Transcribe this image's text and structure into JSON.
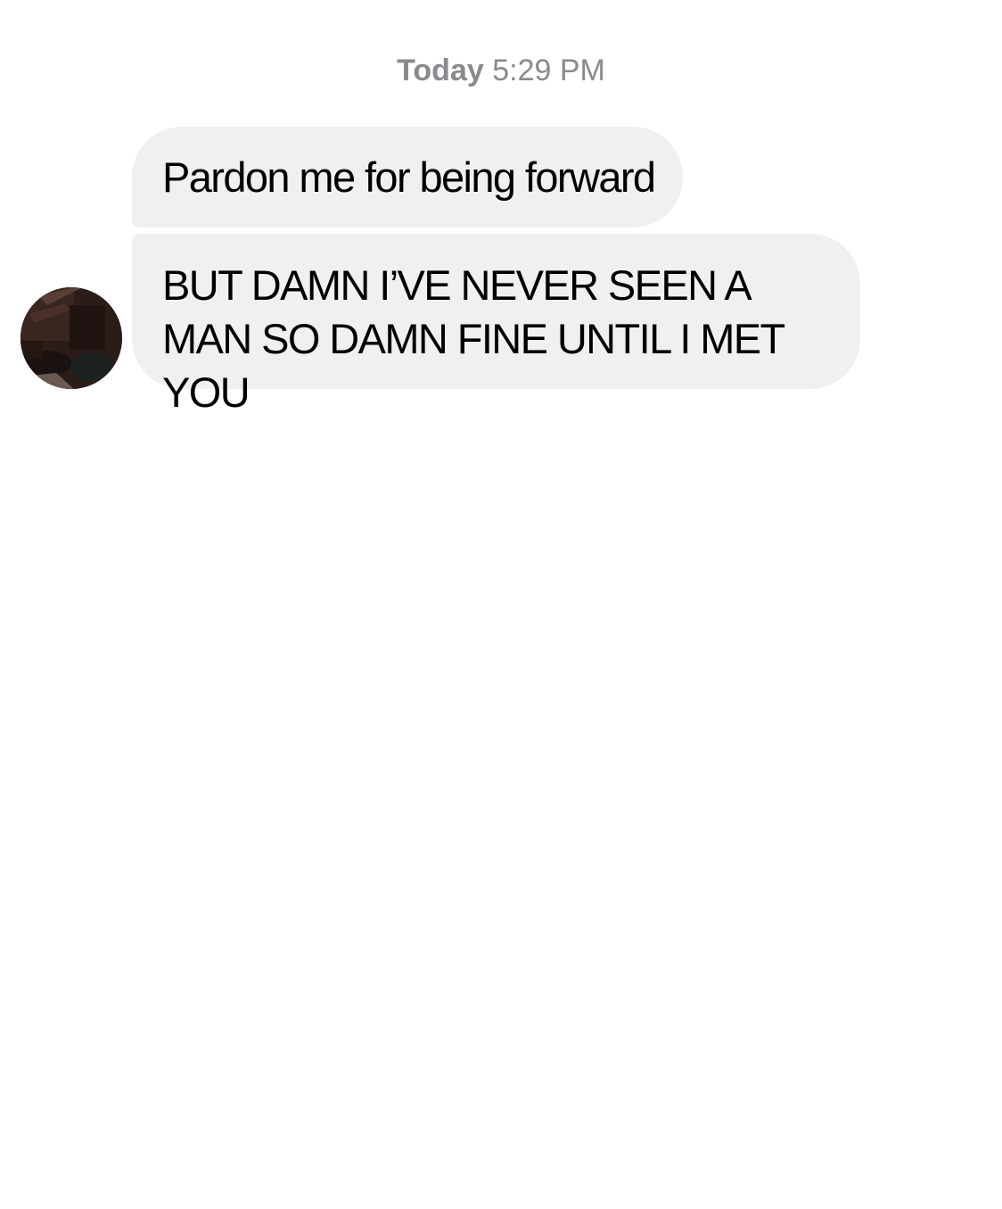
{
  "thread": {
    "timestamp_day": "Today",
    "timestamp_time": "5:29 PM"
  },
  "messages": [
    {
      "sender": "other",
      "text": "Pardon me for being forward"
    },
    {
      "sender": "other",
      "text": "BUT DAMN I’VE NEVER SEEN A MAN SO DAMN FINE UNTIL I MET YOU"
    }
  ],
  "colors": {
    "bubble_background": "#f0f0f0",
    "timestamp_text": "#8a8a8e",
    "message_text": "#000000",
    "page_background": "#ffffff"
  }
}
